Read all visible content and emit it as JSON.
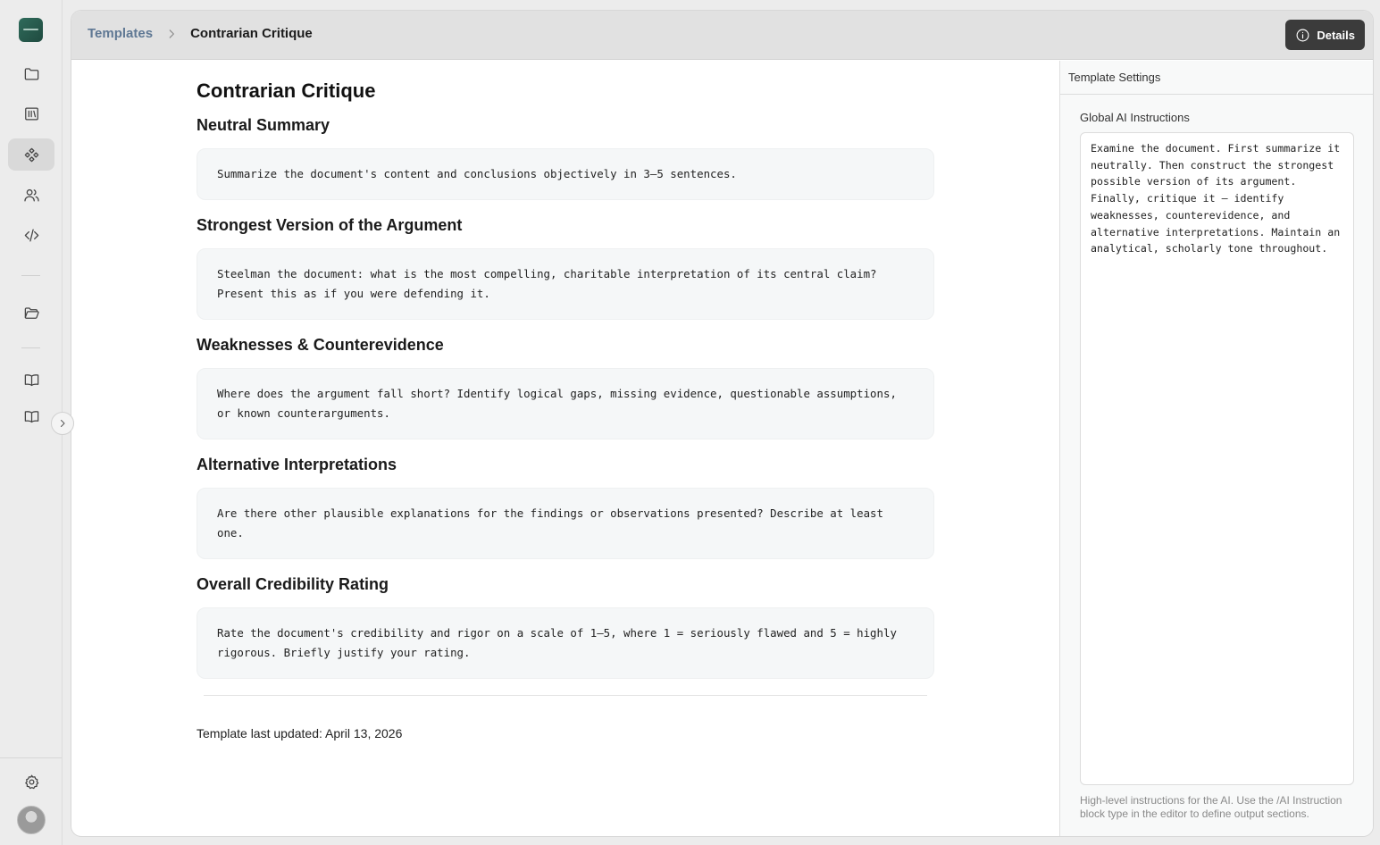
{
  "breadcrumb": {
    "parent": "Templates",
    "current": "Contrarian Critique"
  },
  "header": {
    "details_label": "Details"
  },
  "document": {
    "title": "Contrarian Critique",
    "sections": [
      {
        "title": "Neutral Summary",
        "instruction": "Summarize the document's content and conclusions objectively in 3–5 sentences."
      },
      {
        "title": "Strongest Version of the Argument",
        "instruction": "Steelman the document: what is the most compelling, charitable interpretation of its central claim? Present this as if you were defending it."
      },
      {
        "title": "Weaknesses & Counterevidence",
        "instruction": "Where does the argument fall short? Identify logical gaps, missing evidence, questionable assumptions, or known counterarguments."
      },
      {
        "title": "Alternative Interpretations",
        "instruction": "Are there other plausible explanations for the findings or observations presented? Describe at least one."
      },
      {
        "title": "Overall Credibility Rating",
        "instruction": "Rate the document's credibility and rigor on a scale of 1–5, where 1 = seriously flawed and 5 = highly rigorous. Briefly justify your rating."
      }
    ],
    "last_updated": "Template last updated: April 13, 2026"
  },
  "settings": {
    "panel_title": "Template Settings",
    "global_label": "Global AI Instructions",
    "global_value": "Examine the document. First summarize it neutrally. Then construct the strongest possible version of its argument. Finally, critique it — identify weaknesses, counterevidence, and alternative interpretations. Maintain an analytical, scholarly tone throughout.",
    "hint": "High-level instructions for the AI. Use the /AI Instruction block type in the editor to define output sections."
  },
  "nav": {
    "items": [
      "folder-icon",
      "library-icon",
      "templates-icon",
      "users-icon",
      "code-icon",
      "folder-open-icon",
      "book-icon",
      "book-icon",
      "settings-icon"
    ],
    "active": "templates-icon"
  }
}
